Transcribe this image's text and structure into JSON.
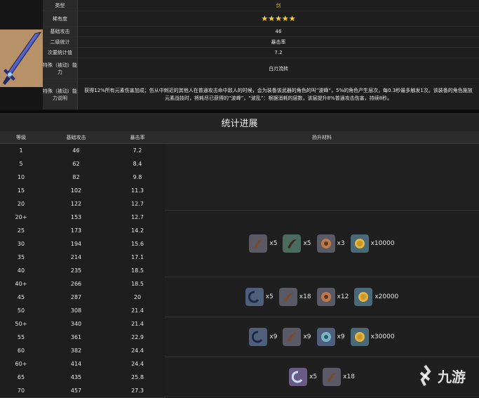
{
  "info": {
    "rows": [
      {
        "key": "类型",
        "value": "剑"
      },
      {
        "key": "稀有度",
        "value": "★★★★★"
      },
      {
        "key": "基础攻击",
        "value": "46"
      },
      {
        "key": "二级统计",
        "value": "暴击率"
      },
      {
        "key": "次要统计值",
        "value": "7.2"
      },
      {
        "key": "特殊（被动）能力",
        "value": "白刃流转"
      },
      {
        "key": "特殊（被动）能力说明",
        "value": "获得12%所有元素伤害加成；伤从中刺近的其他人在普通攻击命中敌人的时候，会为装备该武器的角色的叫”波峰“，5%的角色产生层次，每0.3秒最多触发1次。该装备的角色施放元素战技时，将耗尽已获得的“波峰”，“波乱”：根据消耗的层数，该层提升8%普通攻击伤害，持续8秒。"
      }
    ],
    "weapon_icon": "sword-icon"
  },
  "stats": {
    "title": "统计进展",
    "headers": [
      "等级",
      "基础攻击",
      "暴击率",
      "扬升材料"
    ],
    "rows": [
      {
        "level": "1",
        "atk": "46",
        "crit": "7.2"
      },
      {
        "level": "5",
        "atk": "62",
        "crit": "8.4"
      },
      {
        "level": "10",
        "atk": "82",
        "crit": "9.8"
      },
      {
        "level": "15",
        "atk": "102",
        "crit": "11.3"
      },
      {
        "level": "20",
        "atk": "122",
        "crit": "12.7"
      },
      {
        "level": "20+",
        "atk": "153",
        "crit": "12.7"
      },
      {
        "level": "25",
        "atk": "173",
        "crit": "14.2"
      },
      {
        "level": "30",
        "atk": "194",
        "crit": "15.6"
      },
      {
        "level": "35",
        "atk": "214",
        "crit": "17.1"
      },
      {
        "level": "40",
        "atk": "235",
        "crit": "18.5"
      },
      {
        "level": "40+",
        "atk": "266",
        "crit": "18.5"
      },
      {
        "level": "45",
        "atk": "287",
        "crit": "20"
      },
      {
        "level": "50",
        "atk": "308",
        "crit": "21.4"
      },
      {
        "level": "50+",
        "atk": "340",
        "crit": "21.4"
      },
      {
        "level": "55",
        "atk": "361",
        "crit": "22.9"
      },
      {
        "level": "60",
        "atk": "382",
        "crit": "24.4"
      },
      {
        "level": "60+",
        "atk": "414",
        "crit": "24.4"
      },
      {
        "level": "65",
        "atk": "435",
        "crit": "25.8"
      },
      {
        "level": "70",
        "atk": "457",
        "crit": "27.3"
      }
    ],
    "materials": [
      {
        "items": [
          {
            "icon": "brown-horn-icon",
            "qty": "x5"
          },
          {
            "icon": "dark-horn-icon",
            "qty": "x5"
          },
          {
            "icon": "orange-mask-icon",
            "qty": "x3"
          },
          {
            "icon": "mora-coin-icon",
            "qty": "x10000"
          }
        ]
      },
      {
        "items": [
          {
            "icon": "blue-scroll-icon",
            "qty": "x5"
          },
          {
            "icon": "brown-horn-icon",
            "qty": "x18"
          },
          {
            "icon": "orange-mask-icon",
            "qty": "x12"
          },
          {
            "icon": "mora-coin-icon",
            "qty": "x20000"
          }
        ]
      },
      {
        "items": [
          {
            "icon": "blue-scroll-icon",
            "qty": "x9"
          },
          {
            "icon": "brown-horn-icon",
            "qty": "x9"
          },
          {
            "icon": "blue-mask-icon",
            "qty": "x9"
          },
          {
            "icon": "mora-coin-icon",
            "qty": "x30000"
          }
        ]
      },
      {
        "items": [
          {
            "icon": "purple-scroll-icon",
            "qty": "x5"
          },
          {
            "icon": "brown-horn-icon",
            "qty": "x18"
          }
        ]
      }
    ]
  },
  "watermark": {
    "text": "九游"
  },
  "colors": {
    "gold": "#d6b64a",
    "star": "#ffd21f"
  }
}
